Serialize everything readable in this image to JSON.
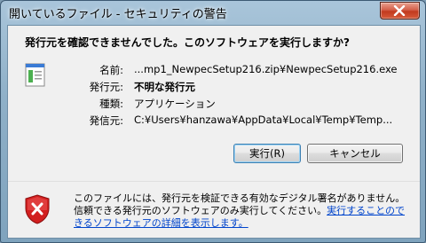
{
  "window": {
    "title": "開いているファイル - セキュリティの警告"
  },
  "dialog": {
    "heading": "発行元を確認できませんでした。このソフトウェアを実行しますか?",
    "details": [
      {
        "label": "名前:",
        "value": "...mp1_NewpecSetup216.zip¥NewpecSetup216.exe",
        "bold": false
      },
      {
        "label": "発行元:",
        "value": "不明な発行元",
        "bold": true
      },
      {
        "label": "種類:",
        "value": "アプリケーション",
        "bold": false
      },
      {
        "label": "発信元:",
        "value": "C:¥Users¥hanzawa¥AppData¥Local¥Temp¥Temp...",
        "bold": false
      }
    ],
    "run_button": "実行(R)",
    "cancel_button": "キャンセル",
    "footer_text": "このファイルには、発行元を検証できる有効なデジタル署名がありません。信頼できる発行元のソフトウェアのみ実行してください。",
    "footer_link": "実行することのできるソフトウェアの詳細を表示します。"
  },
  "icons": {
    "close": "close-icon",
    "file": "file-icon",
    "warning": "shield-error-icon"
  },
  "colors": {
    "link": "#0044cc",
    "close_button": "#c23a1e",
    "shield_red": "#d21f1f"
  }
}
